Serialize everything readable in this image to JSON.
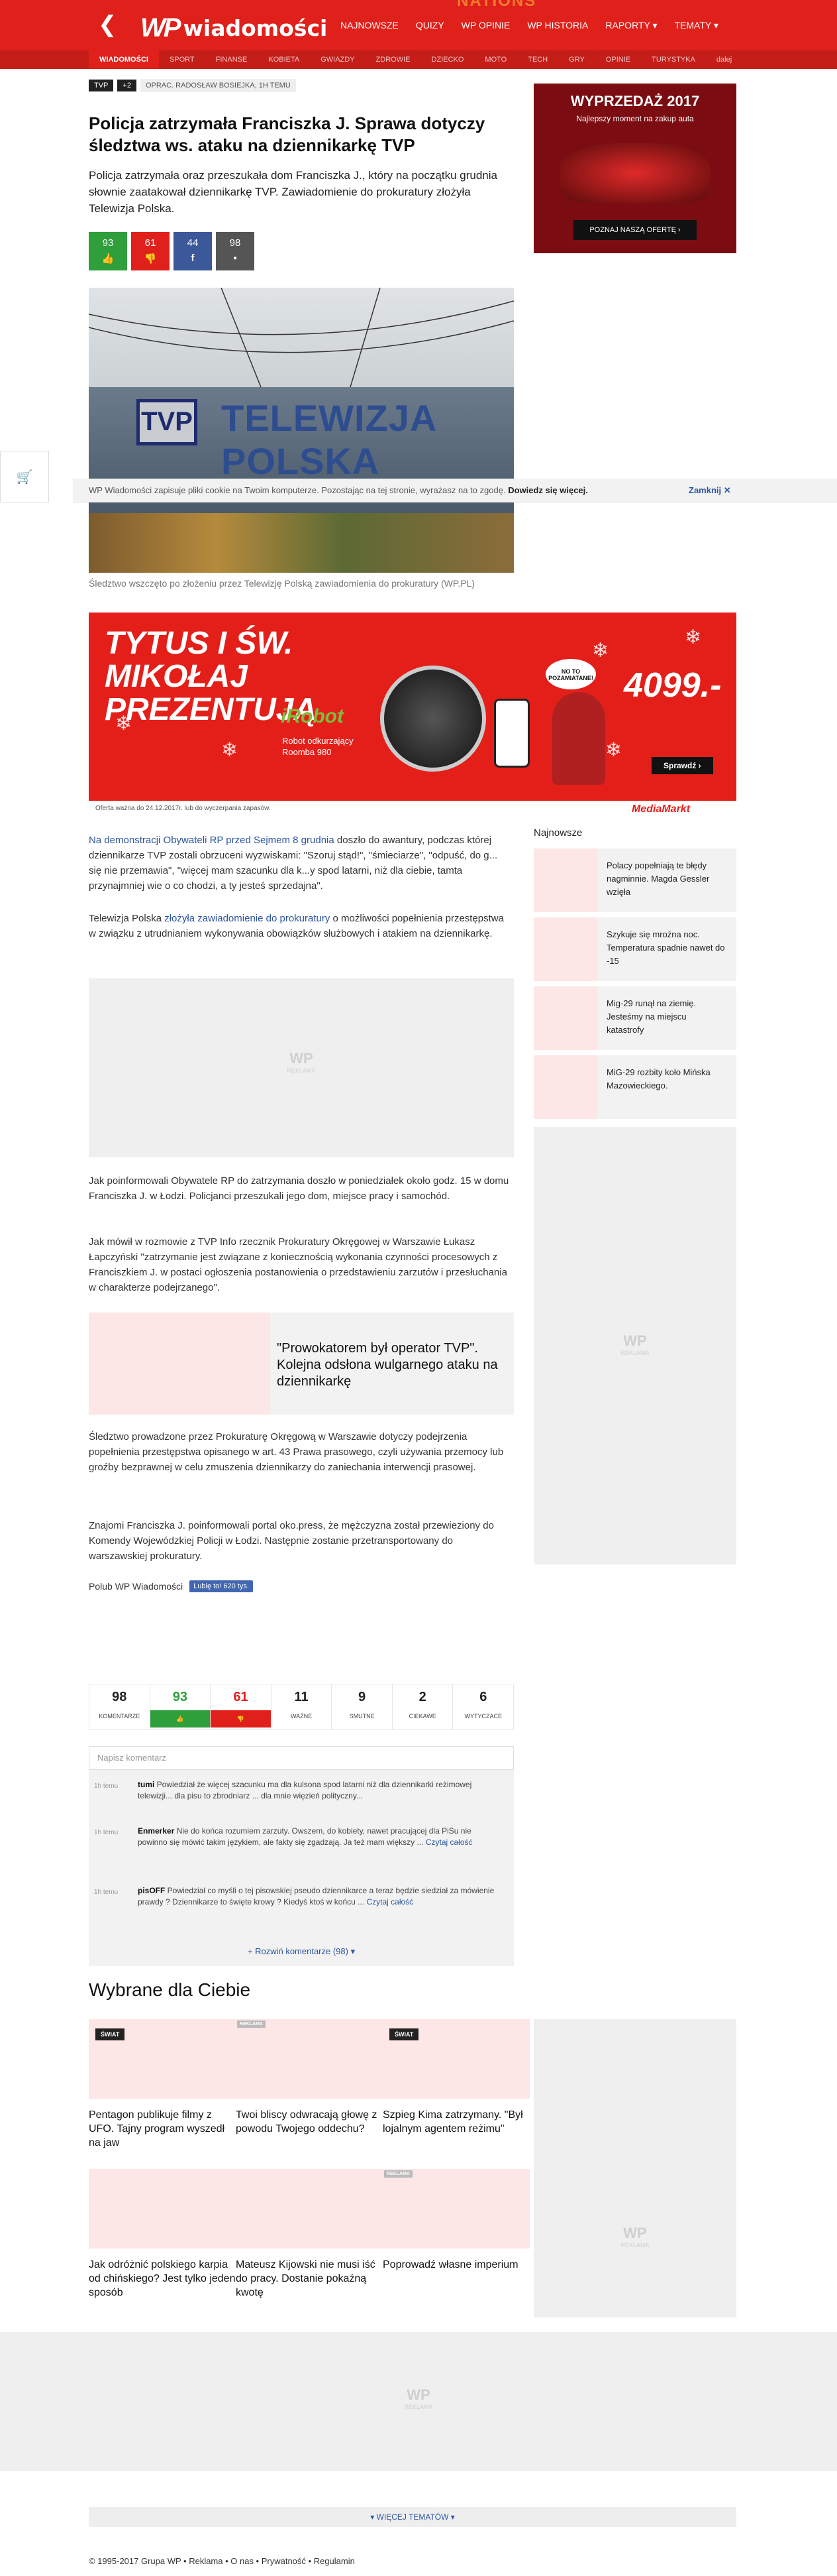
{
  "header": {
    "logo_wp": "WP",
    "logo_name": "wiadomości",
    "back_glyph": "❮",
    "watermark": "NATIONS",
    "nav": [
      "NAJNOWSZE",
      "QUIZY",
      "WP OPINIE",
      "WP HISTORIA",
      "RAPORTY ▾",
      "TEMATY ▾"
    ],
    "subnav": [
      "WIADOMOŚCI",
      "SPORT",
      "FINANSE",
      "KOBIETA",
      "GWIAZDY",
      "ZDROWIE",
      "DZIECKO",
      "MOTO",
      "TECH",
      "GRY",
      "OPINIE",
      "TURYSTYKA",
      "dalej"
    ],
    "accent": "#e0201b"
  },
  "article": {
    "tag": "TVP",
    "tag_more": "+2",
    "author": "OPRAC. RADOSŁAW BOSIEJKA, 1H TEMU",
    "title": "Policja zatrzymała Franciszka J. Sprawa dotyczy śledztwa ws. ataku na dziennikarkę TVP",
    "lead": "Policja zatrzymała oraz przeszukała dom Franciszka J., który na początku grudnia słownie zaatakował dziennikarkę TVP. Zawiadomienie do prokuratury złożyła Telewizja Polska.",
    "votes": [
      {
        "count": "93",
        "icon": "👍",
        "name": "like-icon"
      },
      {
        "count": "61",
        "icon": "👎",
        "name": "dislike-icon"
      },
      {
        "count": "44",
        "icon": "f",
        "name": "facebook-icon"
      },
      {
        "count": "98",
        "icon": "▪",
        "name": "comment-icon"
      }
    ],
    "photo_sign_left": "TVP",
    "photo_sign_right": "TELEWIZJA POLSKA",
    "caption": "Śledztwo wszczęto po złożeniu przez Telewizję Polską zawiadomienia do prokuratury (WP.PL)",
    "p1_link": "Na demonstracji Obywateli RP przed Sejmem 8 grudnia",
    "p1_rest": " doszło do awantury, podczas której dziennikarze TVP zostali obrzuceni wyzwiskami: \"Szoruj stąd!\", \"śmieciarze\", \"odpuść, do g... się nie przemawia\", \"więcej mam szacunku dla k...y spod latarni, niż dla ciebie, tamta przynajmniej wie o co chodzi, a ty jesteś sprzedajna\".",
    "p2_a": "Telewizja Polska ",
    "p2_link": "złożyła zawiadomienie do prokuratury",
    "p2_b": " o możliwości popełnienia przestępstwa w związku z utrudnianiem wykonywania obowiązków służbowych i atakiem na dziennikarkę.",
    "p3": "Jak poinformowali Obywatele RP do zatrzymania doszło w poniedziałek około godz. 15 w domu Franciszka J. w Łodzi. Policjanci przeszukali jego dom, miejsce pracy i samochód.",
    "p4": "Jak mówił w rozmowie z TVP Info rzecznik Prokuratury Okręgowej w Warszawie Łukasz Łapczyński \"zatrzymanie jest związane z koniecznością wykonania czynności procesowych z Franciszkiem J. w postaci ogłoszenia postanowienia o przedstawieniu zarzutów i przesłuchania w charakterze podejrzanego\".",
    "related": "\"Prowokatorem był operator TVP\". Kolejna odsłona wulgarnego ataku na dziennikarkę",
    "p5": "Śledztwo prowadzone przez Prokuraturę Okręgową w Warszawie dotyczy podejrzenia popełnienia przestępstwa opisanego w art. 43 Prawa prasowego, czyli używania przemocy lub groźby bezprawnej w celu zmuszenia dziennikarzy do zaniechania interwencji prasowej.",
    "p6": "Znajomi Franciszka J. poinformowali portal oko.press, że mężczyzna został przewieziony do Komendy Wojewódzkiej Policji w Łodzi. Następnie zostanie przetransportowany do warszawskiej prokuratury.",
    "fb_label": "Polub WP Wiadomości",
    "fb_button": "Lubię to! 620 tys."
  },
  "cookie": {
    "text": "WP Wiadomości zapisuje pliki cookie na Twoim komputerze. Pozostając na tej stronie, wyrażasz na to zgodę.",
    "link": "Dowiedz się więcej.",
    "close": "Zamknij ✕",
    "side_icon": "🛒"
  },
  "big_ad": {
    "headline": "TYTUS I ŚW. MIKOŁAJ PREZENTUJĄ",
    "brand": "iRobot",
    "product": "Robot odkurzający Roomba 980",
    "bubble": "NO TO POZAMIATANE!",
    "price": "4099.-",
    "cta": "Sprawdź ›",
    "legal": "Oferta ważna do 24.12.2017r. lub do wyczerpania zapasów.",
    "store": "MediaMarkt"
  },
  "side_ad": {
    "headline": "WYPRZEDAŻ 2017",
    "sub": "Najlepszy moment na zakup auta",
    "cta": "POZNAJ NASZĄ OFERTĘ ›"
  },
  "ad_mark": {
    "logo": "WP",
    "label": "REKLAMA"
  },
  "sidebar": {
    "heading": "Najnowsze",
    "items": [
      "Polacy popełniają te błędy nagminnie. Magda Gessler wzięła",
      "Szykuje się mroźna noc. Temperatura spadnie nawet do -15",
      "Mig-29 runął na ziemię. Jesteśmy na miejscu katastrofy",
      "MiG-29 rozbity koło Mińska Mazowieckiego."
    ]
  },
  "comments": {
    "stats": [
      {
        "n": "98",
        "l": "KOMENTARZE"
      },
      {
        "n": "93",
        "l": "👍"
      },
      {
        "n": "61",
        "l": "👎"
      },
      {
        "n": "11",
        "l": "WAŻNE"
      },
      {
        "n": "9",
        "l": "SMUTNE"
      },
      {
        "n": "2",
        "l": "CIEKAWE"
      },
      {
        "n": "6",
        "l": "WYTYCZACE"
      }
    ],
    "placeholder": "Napisz komentarz",
    "items": [
      {
        "time": "1h temu",
        "user": "tumi",
        "text": " Powiedział że więcej szacunku ma dla kulsona spod latarni niż dla dziennikarki reżimowej telewizji... dla pisu to zbrodniarz ... dla mnie więzień polityczny...",
        "more": ""
      },
      {
        "time": "1h temu",
        "user": "Enmerker",
        "text": " Nie do końca rozumiem zarzuty. Owszem, do kobiety, nawet pracującej dla PiSu nie powinno się mówić takim językiem, ale fakty się zgadzają. Ja też mam większy ...",
        "more": "Czytaj całość"
      },
      {
        "time": "1h temu",
        "user": "pisOFF",
        "text": " Powiedział co myśli o tej pisowskiej pseudo dziennikarce a teraz będzie siedział za mówienie prawdy ? Dziennikarze to święte krowy ? Kiedyś ktoś w końcu ...",
        "more": "Czytaj całość"
      }
    ],
    "more": "+ Rozwiń komentarze (98) ▾"
  },
  "wybrane": {
    "heading": "Wybrane dla Ciebie",
    "cards": [
      {
        "badge": "ŚWIAT",
        "title": "Pentagon publikuje filmy z UFO. Tajny program wyszedł na jaw"
      },
      {
        "badge": "REKLAMA",
        "title": "Twoi bliscy odwracają głowę z powodu Twojego oddechu?"
      },
      {
        "badge": "ŚWIAT",
        "title": "Szpieg Kima zatrzymany. \"Był lojalnym agentem reżimu\""
      },
      {
        "badge": "",
        "title": "Jak odróżnić polskiego karpia od chińskiego? Jest tylko jeden sposób"
      },
      {
        "badge": "",
        "title": "Mateusz Kijowski nie musi iść do pracy. Dostanie pokaźną kwotę"
      },
      {
        "badge": "REKLAMA",
        "title": "Poprowadź własne imperium"
      }
    ]
  },
  "footer": {
    "more_topics": "▾ WIĘCEJ TEMATÓW ▾",
    "copyright": "© 1995-2017 Grupa WP  •  Reklama  •  O nas  •  Prywatność  •  Regulamin"
  }
}
